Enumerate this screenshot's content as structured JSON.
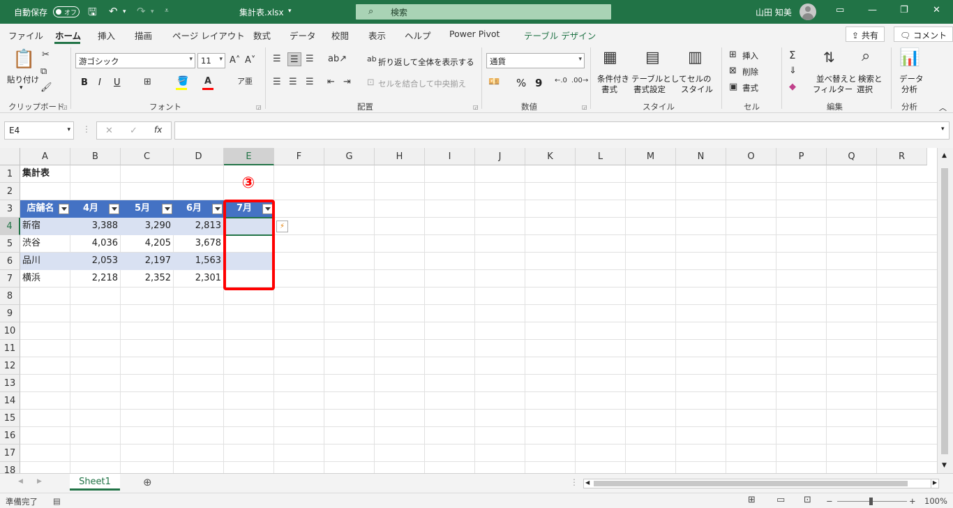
{
  "titlebar": {
    "autosave_label": "自動保存",
    "autosave_state": "オフ",
    "filename": "集計表.xlsx",
    "search_placeholder": "検索",
    "user_name": "山田 知美"
  },
  "ribbon_tabs": [
    "ファイル",
    "ホーム",
    "挿入",
    "描画",
    "ページ レイアウト",
    "数式",
    "データ",
    "校閲",
    "表示",
    "ヘルプ",
    "Power Pivot",
    "テーブル デザイン"
  ],
  "active_tab": "ホーム",
  "share_label": "共有",
  "comment_label": "コメント",
  "clipboard": {
    "paste_label": "貼り付け",
    "group_label": "クリップボード"
  },
  "font": {
    "name": "游ゴシック",
    "size": "11",
    "bold": "B",
    "italic": "I",
    "underline": "U",
    "group_label": "フォント"
  },
  "alignment": {
    "wrap_label": "折り返して全体を表示する",
    "merge_label": "セルを結合して中央揃え",
    "group_label": "配置"
  },
  "number": {
    "format": "通貨",
    "percent": "%",
    "comma": "9",
    "group_label": "数値"
  },
  "styles": {
    "conditional_label_1": "条件付き",
    "conditional_label_2": "書式",
    "table_label_1": "テーブルとして",
    "table_label_2": "書式設定",
    "cell_label_1": "セルの",
    "cell_label_2": "スタイル",
    "group_label": "スタイル"
  },
  "cells": {
    "insert_label": "挿入",
    "delete_label": "削除",
    "format_label": "書式",
    "group_label": "セル"
  },
  "editing": {
    "sort_label_1": "並べ替えと",
    "sort_label_2": "フィルター",
    "find_label_1": "検索と",
    "find_label_2": "選択",
    "group_label": "編集"
  },
  "analysis": {
    "label_1": "データ",
    "label_2": "分析",
    "group_label": "分析"
  },
  "formula_bar": {
    "name_box": "E4",
    "fx": "fx",
    "formula": ""
  },
  "columns": [
    "A",
    "B",
    "C",
    "D",
    "E",
    "F",
    "G",
    "H",
    "I",
    "J",
    "K",
    "L",
    "M",
    "N",
    "O",
    "P",
    "Q",
    "R"
  ],
  "rows": [
    "1",
    "2",
    "3",
    "4",
    "5",
    "6",
    "7",
    "8",
    "9",
    "10",
    "11",
    "12",
    "13",
    "14",
    "15",
    "16",
    "17",
    "18"
  ],
  "sheet": {
    "title": "集計表",
    "headers": [
      "店舗名",
      "4月",
      "5月",
      "6月",
      "7月"
    ],
    "data": [
      [
        "新宿",
        "3,388",
        "3,290",
        "2,813",
        ""
      ],
      [
        "渋谷",
        "4,036",
        "4,205",
        "3,678",
        ""
      ],
      [
        "品川",
        "2,053",
        "2,197",
        "1,563",
        ""
      ],
      [
        "横浜",
        "2,218",
        "2,352",
        "2,301",
        ""
      ]
    ]
  },
  "annotation_marker": "③",
  "sheet_tab": "Sheet1",
  "status": {
    "ready": "準備完了",
    "zoom": "100%"
  },
  "colors": {
    "excel_green": "#217346",
    "table_header": "#4472c4",
    "table_band": "#d9e1f2",
    "highlight": "#ff0000"
  }
}
